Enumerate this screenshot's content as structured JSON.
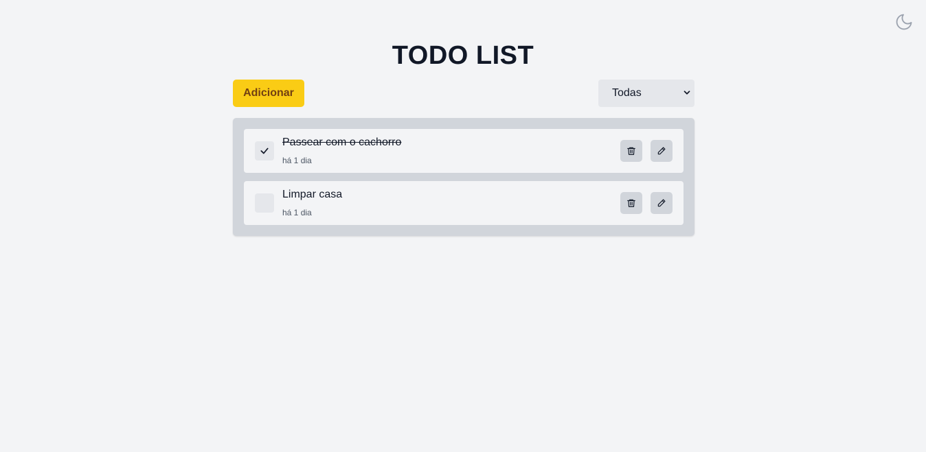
{
  "header": {
    "title": "TODO LIST",
    "theme_icon": "moon-icon"
  },
  "toolbar": {
    "add_label": "Adicionar",
    "filter_selected": "Todas"
  },
  "todos": [
    {
      "title": "Passear com o cachorro",
      "time": "há 1 dia",
      "done": true
    },
    {
      "title": "Limpar casa",
      "time": "há 1 dia",
      "done": false
    }
  ],
  "colors": {
    "background": "#f3f4f6",
    "accent": "#facc15",
    "panel": "#d1d5db"
  }
}
